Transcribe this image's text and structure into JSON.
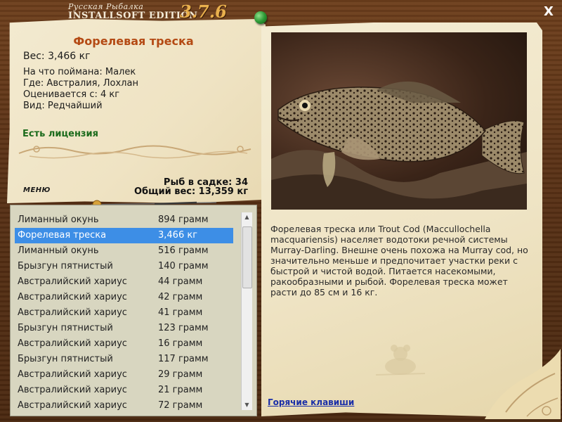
{
  "app": {
    "title_line1": "Русская Рыбалка",
    "title_line2": "INSTALLSOFT EDITION",
    "version": "3.7.6",
    "close_label": "X"
  },
  "fish": {
    "name": "Форелевая треска",
    "weight": "Вес: 3,466 кг",
    "caught_on": "На что поймана: Малек",
    "where": "Где: Австралия, Лохлан",
    "valued_from": "Оценивается с: 4 кг",
    "kind": "Вид: Редчайший",
    "license": "Есть лицензия",
    "description": "Форелевая треска или Trout Cod (Maccullochella macquariensis) населяет водотоки речной системы Murray-Darling. Внешне очень похожа на Murray cod, но значительно меньше и предпочитает участки реки с быстрой и чистой водой. Питается насекомыми, ракообразными и рыбой. Форелевая треска может расти до 85 см и 16 кг."
  },
  "menu": {
    "label": "МЕНЮ"
  },
  "keepnet": {
    "count": "Рыб в садке: 34",
    "total_weight": "Общий вес: 13,359 кг"
  },
  "catch_list": [
    {
      "name": "Лиманный окунь",
      "weight": "894 грамм",
      "selected": false
    },
    {
      "name": "Форелевая треска",
      "weight": "3,466 кг",
      "selected": true
    },
    {
      "name": "Лиманный окунь",
      "weight": "516 грамм",
      "selected": false
    },
    {
      "name": "Брызгун пятнистый",
      "weight": "140 грамм",
      "selected": false
    },
    {
      "name": "Австралийский хариус",
      "weight": "44 грамм",
      "selected": false
    },
    {
      "name": "Австралийский хариус",
      "weight": "42 грамм",
      "selected": false
    },
    {
      "name": "Австралийский хариус",
      "weight": "41 грамм",
      "selected": false
    },
    {
      "name": "Брызгун пятнистый",
      "weight": "123 грамм",
      "selected": false
    },
    {
      "name": "Австралийский хариус",
      "weight": "16 грамм",
      "selected": false
    },
    {
      "name": "Брызгун пятнистый",
      "weight": "117 грамм",
      "selected": false
    },
    {
      "name": "Австралийский хариус",
      "weight": "29 грамм",
      "selected": false
    },
    {
      "name": "Австралийский хариус",
      "weight": "21 грамм",
      "selected": false
    },
    {
      "name": "Австралийский хариус",
      "weight": "72 грамм",
      "selected": false
    }
  ],
  "hotkeys": {
    "label": "Горячие клавиши"
  },
  "colors": {
    "title_accent": "#b44a14",
    "license_green": "#1c6b1c",
    "selection_blue": "#3d8ee6",
    "link_blue": "#1a2ea8"
  },
  "icons": {
    "pin": "green-pin-icon",
    "close": "close-icon",
    "scroll_up": "scroll-up-arrow-icon",
    "scroll_down": "scroll-down-arrow-icon"
  }
}
